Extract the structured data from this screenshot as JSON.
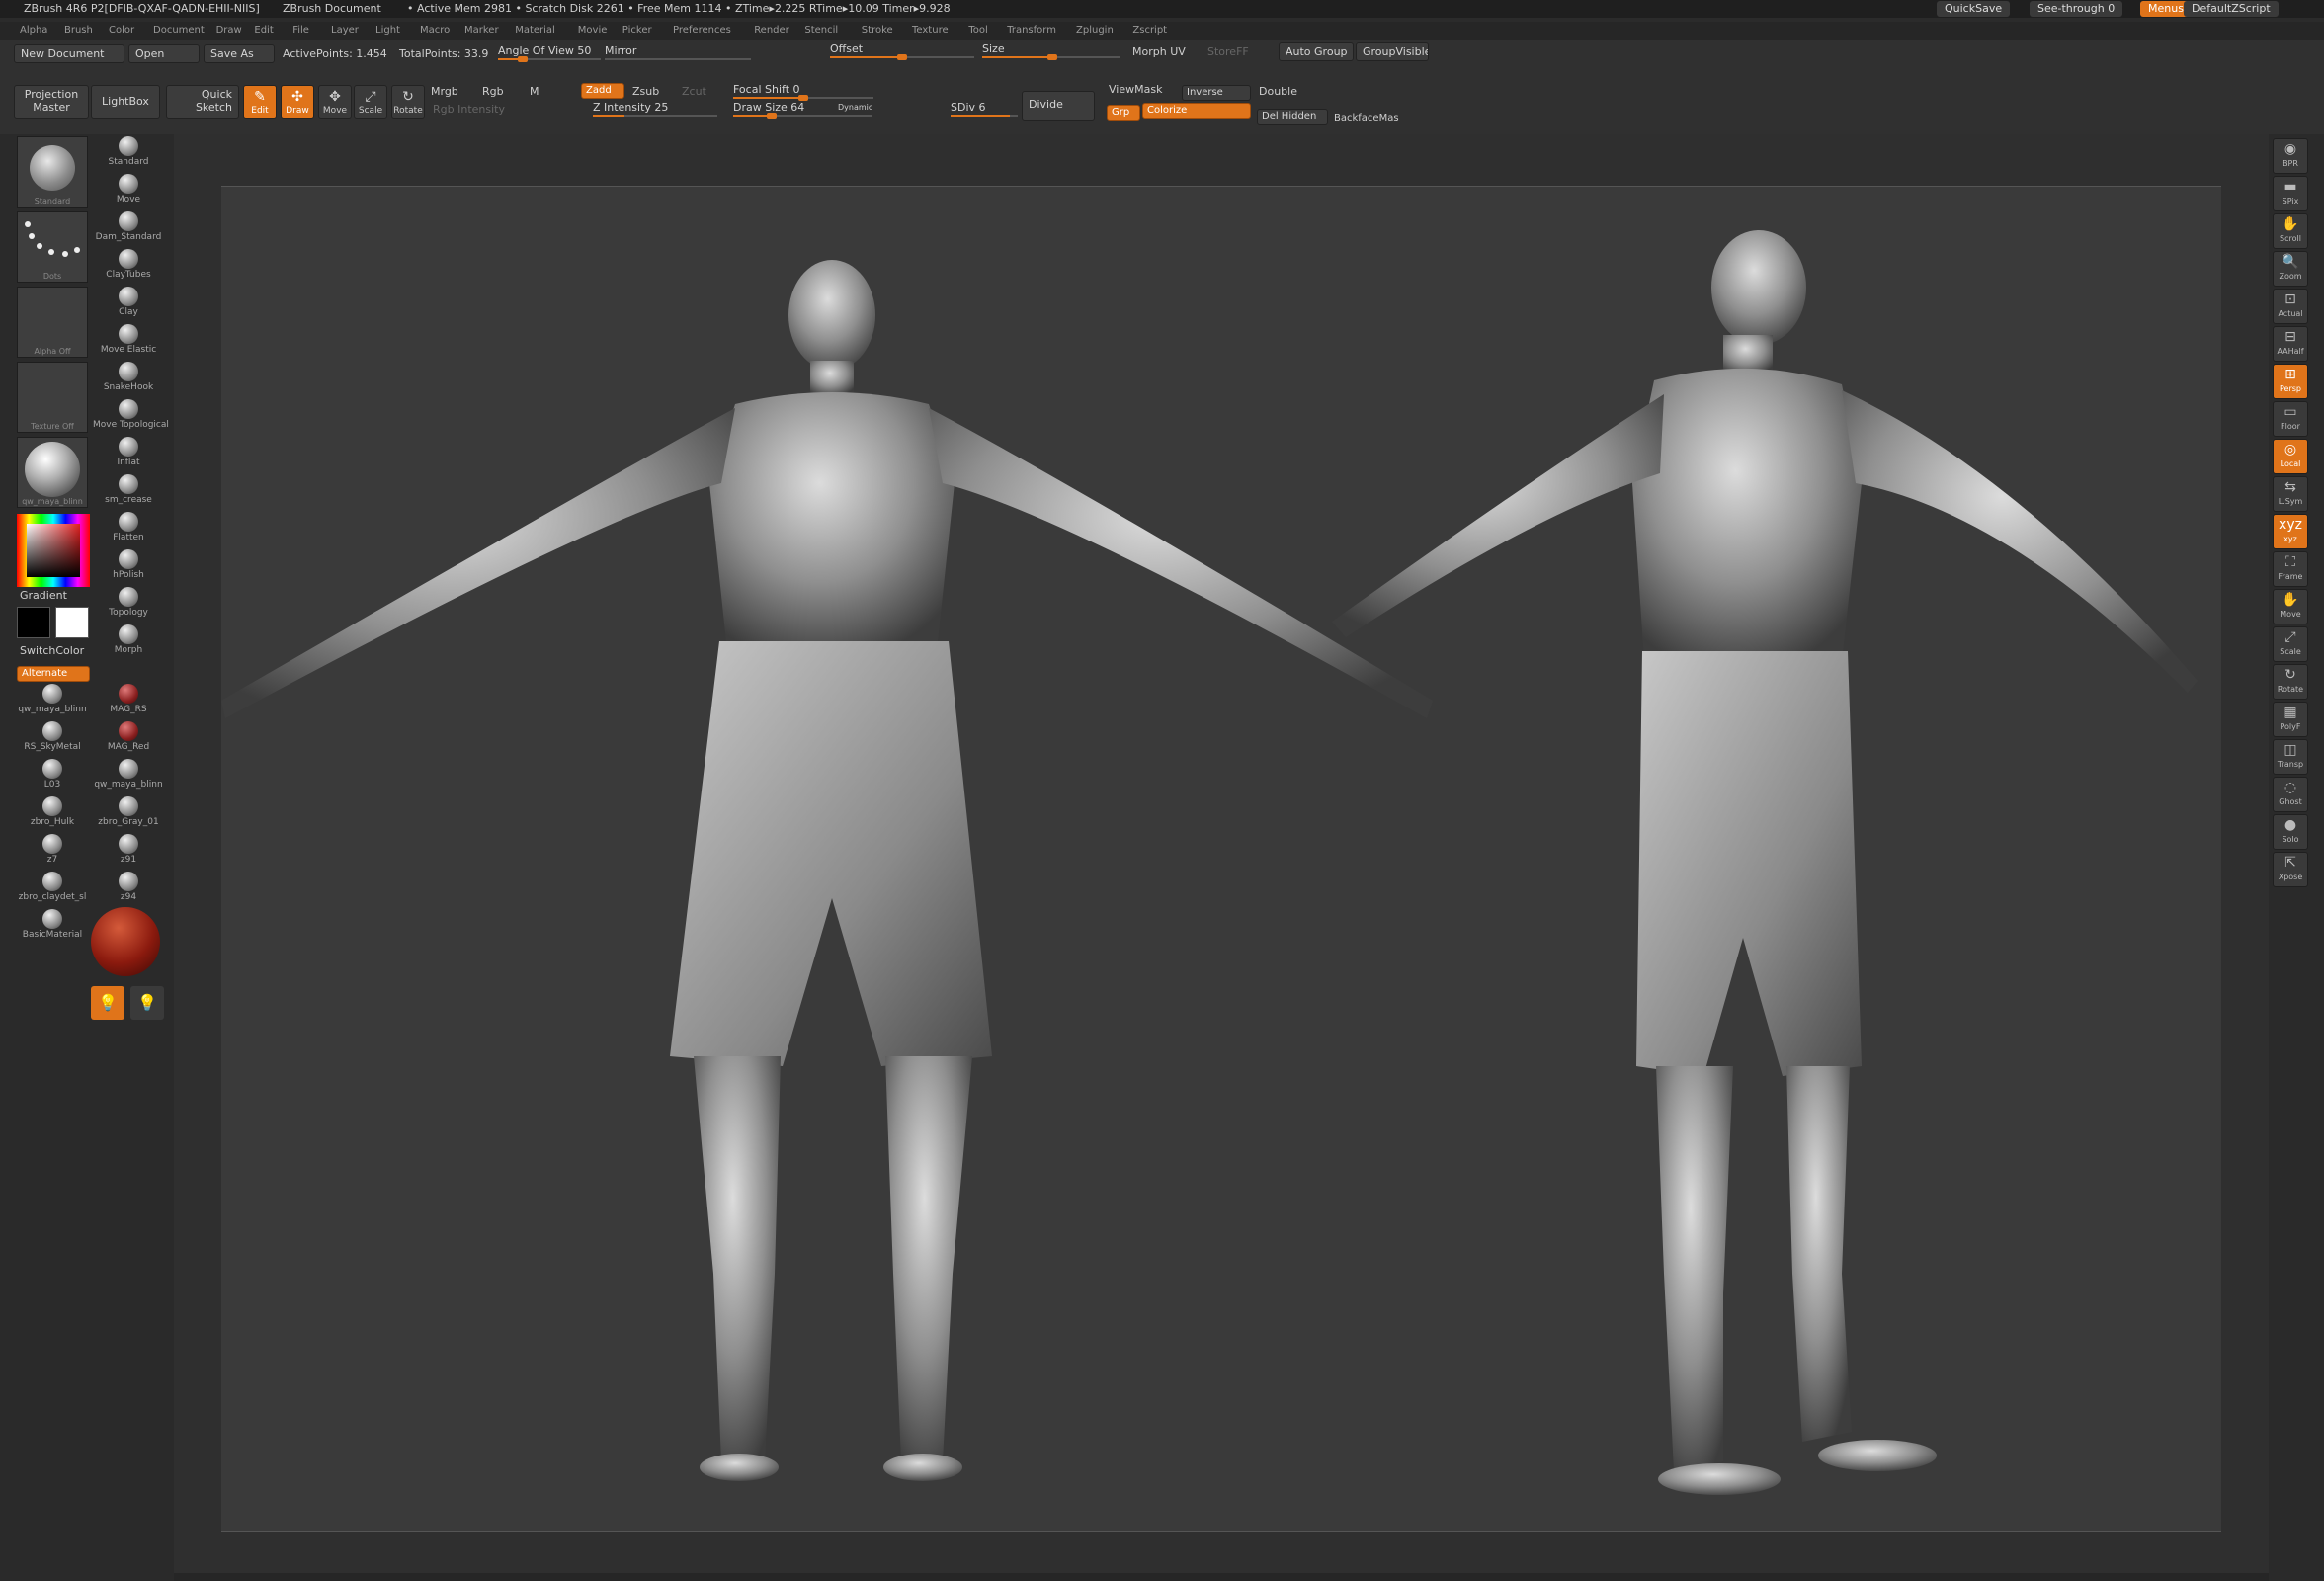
{
  "titlebar": {
    "app": "ZBrush 4R6 P2[DFIB-QXAF-QADN-EHII-NIIS]",
    "doc": "ZBrush Document",
    "stats": "• Active Mem 2981 • Scratch Disk 2261 • Free Mem 1114 • ZTime▸2.225 RTime▸10.09 Timer▸9.928",
    "quicksave": "QuickSave",
    "see_through": "See-through  0",
    "menus": "Menus",
    "script": "DefaultZScript"
  },
  "menubar": [
    "Alpha",
    "Brush",
    "Color",
    "Document",
    "Draw",
    "Edit",
    "File",
    "Layer",
    "Light",
    "Macro",
    "Marker",
    "Material",
    "Movie",
    "Picker",
    "Preferences",
    "Render",
    "Stencil",
    "Stroke",
    "Texture",
    "Tool",
    "Transform",
    "Zplugin",
    "Zscript"
  ],
  "toolbar": {
    "new_document": "New Document",
    "open": "Open",
    "save_as": "Save As",
    "active_points": "ActivePoints: 1.454",
    "total_points": "TotalPoints: 33.9",
    "angle_of_view": "Angle Of View 50",
    "mirror": "Mirror",
    "offset": "Offset",
    "size": "Size",
    "morph_uv": "Morph UV",
    "store": "StoreFF",
    "auto_group": "Auto Group",
    "group_visible": "GroupVisible",
    "projection_master": "Projection Master",
    "lightbox": "LightBox",
    "quick_sketch": "Quick Sketch",
    "edit": "Edit",
    "draw": "Draw",
    "move": "Move",
    "scale": "Scale",
    "rotate": "Rotate",
    "mrgb": "Mrgb",
    "rgb": "Rgb",
    "m": "M",
    "rgb_intensity": "Rgb Intensity",
    "zadd": "Zadd",
    "zsub": "Zsub",
    "zcut": "Zcut",
    "z_intensity": "Z Intensity 25",
    "z_intensity_value": 25,
    "focal_shift": "Focal Shift 0",
    "focal_shift_value": 0,
    "draw_size": "Draw Size 64",
    "draw_size_value": 64,
    "dynamic": "Dynamic",
    "sdiv": "SDiv 6",
    "sdiv_value": 6,
    "divide": "Divide",
    "viewmask": "ViewMask",
    "inverse": "Inverse",
    "double": "Double",
    "grp": "Grp",
    "colorize": "Colorize",
    "del_hidden": "Del Hidden",
    "backface": "BackfaceMas"
  },
  "left_palette": {
    "big": [
      {
        "name": "Standard",
        "caption": "Standard"
      },
      {
        "name": "Dots",
        "caption": "Dots"
      },
      {
        "name": "Alpha Off",
        "caption": "Alpha  Off"
      },
      {
        "name": "Texture Off",
        "caption": "Texture  Off"
      },
      {
        "name": "qw_maya_blinn",
        "caption": "qw_maya_blinn"
      }
    ],
    "brushes": [
      "Standard",
      "Move",
      "Dam_Standard",
      "ClayTubes",
      "Clay",
      "Move Elastic",
      "SnakeHook",
      "Move Topological",
      "Inflat",
      "sm_crease",
      "Flatten",
      "hPolish",
      "Topology",
      "Morph"
    ],
    "gradient": "Gradient",
    "switch_color": "SwitchColor",
    "alternate": "Alternate",
    "materials_left": [
      "qw_maya_blinn",
      "RS_SkyMetal",
      "L03",
      "zbro_Hulk",
      "z7",
      "zbro_claydet_sl",
      "BasicMaterial"
    ],
    "materials_right": [
      "MAG_RS",
      "MAG_Red",
      "qw_maya_blinn",
      "zbro_Gray_01",
      "z91",
      "z94"
    ],
    "accent": "#e0741a"
  },
  "right_shelf": [
    "BPR",
    "SPix",
    "Scroll",
    "Zoom",
    "Actual",
    "AAHalf",
    "Persp",
    "Floor",
    "Local",
    "L.Sym",
    "xyz",
    "Frame",
    "Move",
    "Scale",
    "Rotate",
    "PolyF",
    "Transp",
    "Ghost",
    "Solo",
    "Xpose"
  ]
}
